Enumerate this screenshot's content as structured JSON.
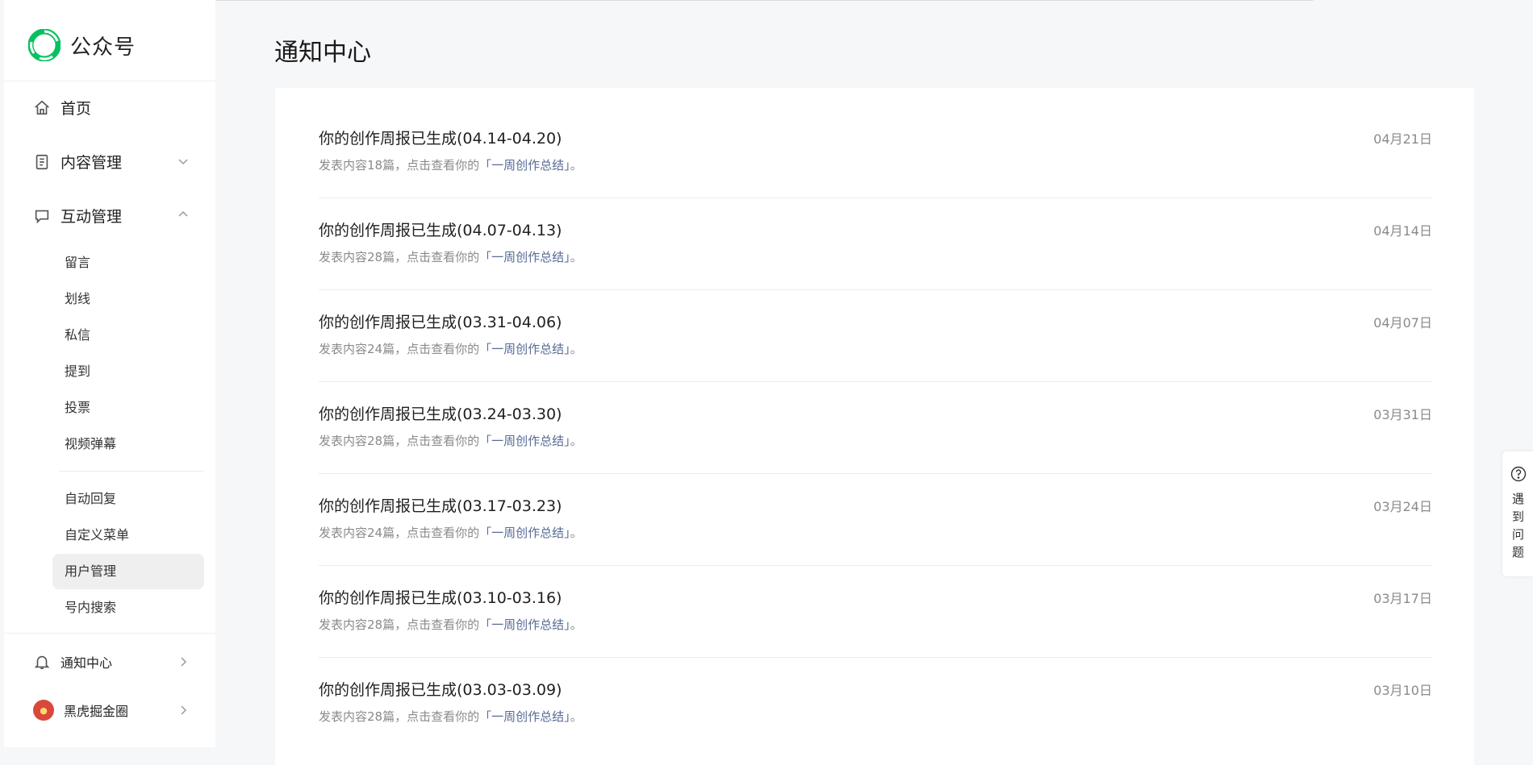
{
  "app": {
    "name": "公众号"
  },
  "sidebar": {
    "home": "首页",
    "content_mgmt": "内容管理",
    "interaction_mgmt": "互动管理",
    "sub_items": [
      "留言",
      "划线",
      "私信",
      "提到",
      "投票",
      "视频弹幕"
    ],
    "sub_items2": [
      "自动回复",
      "自定义菜单",
      "用户管理",
      "号内搜索"
    ],
    "active_sub": "用户管理",
    "notifications": "通知中心",
    "account": "黑虎掘金圈"
  },
  "main": {
    "title": "通知中心",
    "notices": [
      {
        "title": "你的创作周报已生成(04.14-04.20)",
        "desc_prefix": "发表内容18篇，点击查看你的",
        "link": "「一周创作总结」",
        "desc_suffix": "。",
        "date": "04月21日"
      },
      {
        "title": "你的创作周报已生成(04.07-04.13)",
        "desc_prefix": "发表内容28篇，点击查看你的",
        "link": "「一周创作总结」",
        "desc_suffix": "。",
        "date": "04月14日"
      },
      {
        "title": "你的创作周报已生成(03.31-04.06)",
        "desc_prefix": "发表内容24篇，点击查看你的",
        "link": "「一周创作总结」",
        "desc_suffix": "。",
        "date": "04月07日"
      },
      {
        "title": "你的创作周报已生成(03.24-03.30)",
        "desc_prefix": "发表内容28篇，点击查看你的",
        "link": "「一周创作总结」",
        "desc_suffix": "。",
        "date": "03月31日"
      },
      {
        "title": "你的创作周报已生成(03.17-03.23)",
        "desc_prefix": "发表内容24篇，点击查看你的",
        "link": "「一周创作总结」",
        "desc_suffix": "。",
        "date": "03月24日"
      },
      {
        "title": "你的创作周报已生成(03.10-03.16)",
        "desc_prefix": "发表内容28篇，点击查看你的",
        "link": "「一周创作总结」",
        "desc_suffix": "。",
        "date": "03月17日"
      },
      {
        "title": "你的创作周报已生成(03.03-03.09)",
        "desc_prefix": "发表内容28篇，点击查看你的",
        "link": "「一周创作总结」",
        "desc_suffix": "。",
        "date": "03月10日"
      }
    ]
  },
  "help": {
    "label": "遇到问题"
  },
  "colors": {
    "accent_green": "#07c160",
    "link_blue": "#576b95"
  }
}
